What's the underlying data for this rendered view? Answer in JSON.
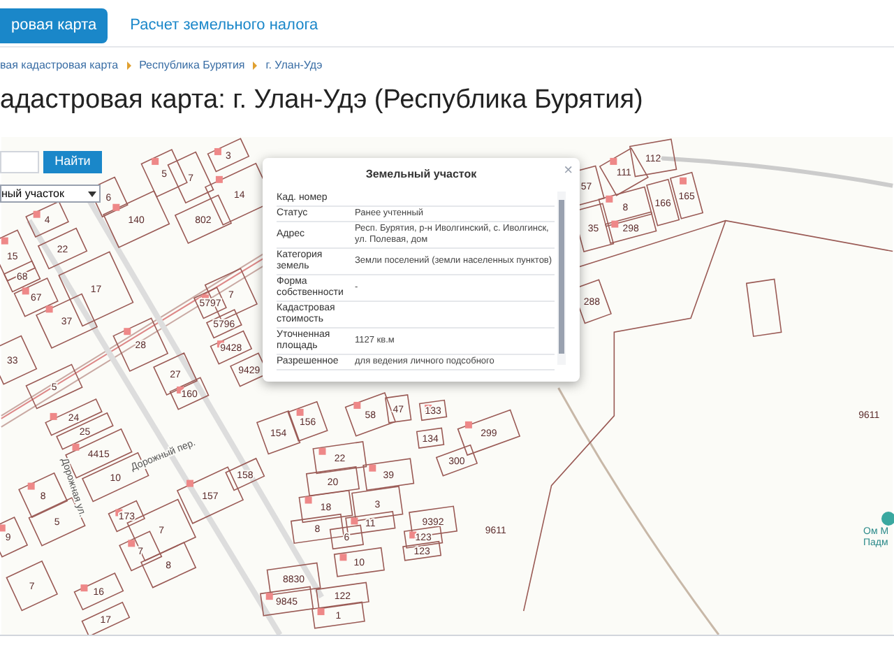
{
  "nav": {
    "tabs": [
      {
        "label": "ровая карта",
        "selected": true
      },
      {
        "label": "Расчет земельного налога",
        "selected": false
      }
    ]
  },
  "breadcrumbs": [
    "вая кадастровая карта",
    "Республика Бурятия",
    "г. Улан-Удэ"
  ],
  "title": "адастровая карта: г. Улан-Удэ (Республика Бурятия)",
  "map": {
    "search": {
      "button": "Найти"
    },
    "layer_select": {
      "value": "ный участок"
    },
    "popup": {
      "title": "Земельный участок",
      "close": "×",
      "rows": [
        {
          "label": "Кад. номер"
        },
        {
          "label": "Статус",
          "value": "Ранее учтенный"
        },
        {
          "label": "Адрес",
          "value": "Респ. Бурятия, р-н Иволгинский, с. Иволгинск, ул. Полевая, дом"
        },
        {
          "label": "Категория земель",
          "value": "Земли поселений (земли населенных пунктов)"
        },
        {
          "label": "Форма собственности",
          "value": "-"
        },
        {
          "label": "Кадастровая стоимость"
        },
        {
          "label": "Уточненная площадь",
          "value": "1127 кв.м"
        },
        {
          "label": "Разрешенное",
          "value": "для ведения личного подсобного"
        }
      ]
    },
    "parcel_numbers": [
      "4",
      "22",
      "15",
      "68",
      "67",
      "17",
      "37",
      "33",
      "140",
      "802",
      "5",
      "7",
      "3",
      "6",
      "14",
      "5",
      "24",
      "25",
      "4415",
      "10",
      "28",
      "27",
      "160",
      "7",
      "5797",
      "5796",
      "9428",
      "9429",
      "8",
      "5",
      "9",
      "7",
      "16",
      "17",
      "157",
      "158",
      "173",
      "7",
      "7",
      "8",
      "22",
      "20",
      "18",
      "8",
      "39",
      "3",
      "11",
      "6",
      "10",
      "8830",
      "9845",
      "122",
      "1",
      "9392",
      "123",
      "123",
      "9611",
      "47",
      "133",
      "134",
      "299",
      "300",
      "58",
      "154",
      "156",
      "112",
      "111",
      "57",
      "8",
      "166",
      "165",
      "35",
      "298",
      "288",
      "9611"
    ],
    "street_labels": [
      "Дорожный пер.",
      "Дорожная ул."
    ],
    "poi": {
      "lines": [
        "Ом М",
        "Падм"
      ]
    }
  }
}
